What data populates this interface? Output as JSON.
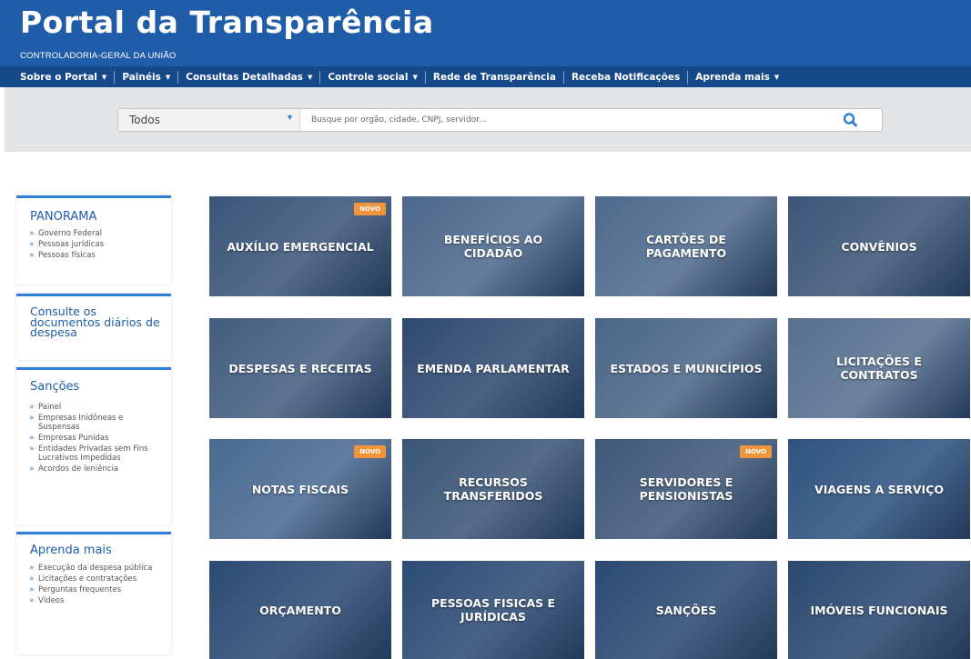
{
  "header": {
    "title": "Portal da Transparência",
    "subtitle": "CONTROLADORIA-GERAL DA UNIÃO"
  },
  "nav": {
    "items": [
      {
        "label": "Sobre o Portal",
        "dropdown": true
      },
      {
        "label": "Painéis",
        "dropdown": true
      },
      {
        "label": "Consultas Detalhadas",
        "dropdown": true
      },
      {
        "label": "Controle social",
        "dropdown": true
      },
      {
        "label": "Rede de Transparência",
        "dropdown": false
      },
      {
        "label": "Receba Notificações",
        "dropdown": false
      },
      {
        "label": "Aprenda mais",
        "dropdown": true
      }
    ]
  },
  "search": {
    "selected": "Todos",
    "placeholder": "Busque por orgão, cidade, CNPJ, servidor...",
    "icon": "search-icon"
  },
  "sidebar": {
    "panorama": {
      "heading": "PANORAMA",
      "items": [
        "Governo Federal",
        "Pessoas jurídicas",
        "Pessoas físicas"
      ]
    },
    "consulte": {
      "heading": "Consulte os documentos diários de despesa"
    },
    "sancoes": {
      "heading": "Sanções",
      "items": [
        "Painel",
        "Empresas Inidôneas e Suspensas",
        "Empresas Punidas",
        "Entidades Privadas sem Fins Lucrativos Impedidas",
        "Acordos de leniência"
      ]
    },
    "aprenda": {
      "heading": "Aprenda mais",
      "items": [
        "Execução da despesa pública",
        "Licitações e contratações",
        "Perguntas frequentes",
        "Vídeos"
      ]
    }
  },
  "tiles": [
    {
      "label": "AUXÍLIO EMERGENCIAL",
      "badge": "NOVO",
      "color": "#3b5579"
    },
    {
      "label": "BENEFÍCIOS AO\nCIDADÃO",
      "badge": "",
      "color": "#4d688c"
    },
    {
      "label": "CARTÕES DE\nPAGAMENTO",
      "badge": "",
      "color": "#4f6a8d"
    },
    {
      "label": "CONVÊNIOS",
      "badge": "",
      "color": "#3c5677"
    },
    {
      "label": "DESPESAS E RECEITAS",
      "badge": "",
      "color": "#435d80"
    },
    {
      "label": "EMENDA PARLAMENTAR",
      "badge": "",
      "color": "#2f4a70"
    },
    {
      "label": "ESTADOS E MUNICÍPIOS",
      "badge": "",
      "color": "#4a6687"
    },
    {
      "label": "LICITAÇÕES E\nCONTRATOS",
      "badge": "",
      "color": "#56708f"
    },
    {
      "label": "NOTAS FISCAIS",
      "badge": "NOVO",
      "color": "#4a6991"
    },
    {
      "label": "RECURSOS\nTRANSFERIDOS",
      "badge": "",
      "color": "#3a5576"
    },
    {
      "label": "SERVIDORES E\nPENSIONISTAS",
      "badge": "NOVO",
      "color": "#3e5878"
    },
    {
      "label": "VIAGENS A SERVIÇO",
      "badge": "",
      "color": "#2e5280"
    },
    {
      "label": "ORÇAMENTO",
      "badge": "",
      "color": "#2c4a74"
    },
    {
      "label": "PESSOAS FISICAS E\nJURÍDICAS",
      "badge": "",
      "color": "#2d4b75"
    },
    {
      "label": "SANÇÕES",
      "badge": "",
      "color": "#2b4972"
    },
    {
      "label": "IMÓVEIS FUNCIONAIS",
      "badge": "",
      "color": "#2a4870"
    }
  ]
}
